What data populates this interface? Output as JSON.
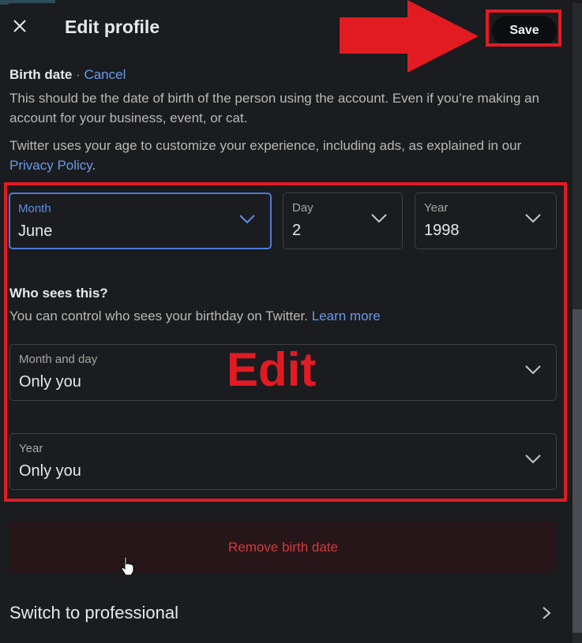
{
  "header": {
    "title": "Edit profile",
    "close_icon": "close-icon",
    "save_label": "Save"
  },
  "birth_date": {
    "title": "Birth date",
    "separator": " · ",
    "cancel_label": "Cancel",
    "description_1": "This should be the date of birth of the person using the account. Even if you’re making an account for your business, event, or cat.",
    "description_2_prefix": "Twitter uses your age to customize your experience, including ads, as explained in our ",
    "privacy_link": "Privacy Policy",
    "description_2_suffix": ".",
    "month": {
      "label": "Month",
      "value": "June"
    },
    "day": {
      "label": "Day",
      "value": "2"
    },
    "year": {
      "label": "Year",
      "value": "1998"
    }
  },
  "visibility": {
    "title": "Who sees this?",
    "description": "You can control who sees your birthday on Twitter. ",
    "learn_more": "Learn more",
    "month_and_day": {
      "label": "Month and day",
      "value": "Only you"
    },
    "year": {
      "label": "Year",
      "value": "Only you"
    }
  },
  "remove_label": "Remove birth date",
  "switch_professional_label": "Switch to professional",
  "annotations": {
    "edit_label": "Edit",
    "color": "#e21b23"
  },
  "colors": {
    "accent_blue": "#6b9ae8",
    "danger_red": "#d5393f",
    "background": "#1a1c1f"
  }
}
